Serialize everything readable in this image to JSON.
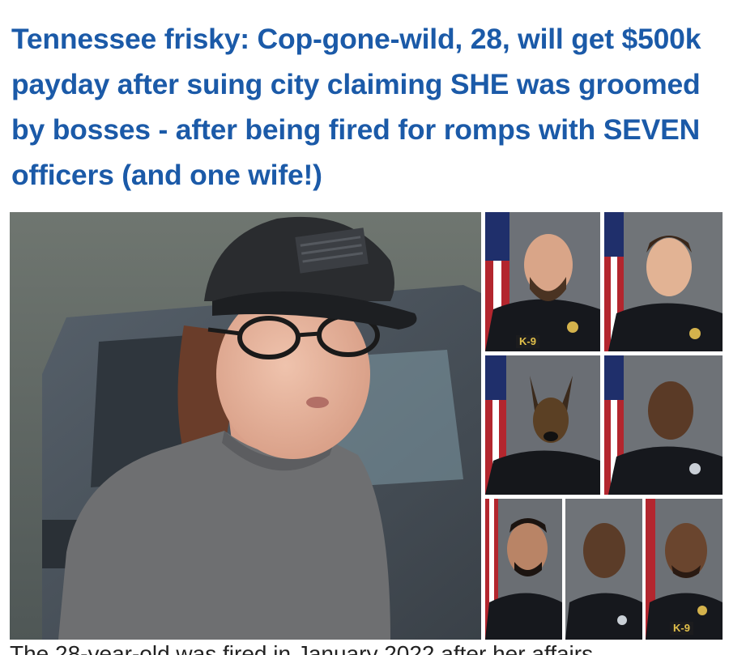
{
  "article": {
    "headline": "Tennessee frisky: Cop-gone-wild, 28, will get $500k payday after suing city claiming SHE was groomed by bosses - after being fired for romps with SEVEN officers (and one wife!)",
    "caption_partial": "The 28-year-old was fired in January 2022 after her affairs"
  },
  "collage": {
    "main_photo": "woman-in-cap-and-glasses",
    "tiles": [
      {
        "subject": "officer-bald-beard",
        "badge": "K-9"
      },
      {
        "subject": "officer-young"
      },
      {
        "subject": "police-dog"
      },
      {
        "subject": "officer-moustache"
      },
      {
        "subject": "officer-goatee"
      },
      {
        "subject": "officer-bald"
      },
      {
        "subject": "officer-bald-beard-2",
        "badge": "K-9"
      }
    ]
  },
  "colors": {
    "headline": "#1b5aa8",
    "uniform": "#16181d",
    "flag_red": "#b3262e",
    "flag_blue": "#1f2f6b"
  }
}
